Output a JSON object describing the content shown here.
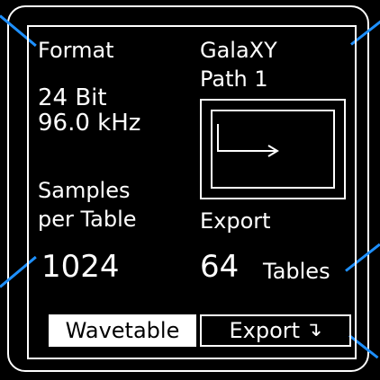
{
  "accent_color": "#1e90ff",
  "format": {
    "label": "Format",
    "bit_depth": "24 Bit",
    "sample_rate": "96.0 kHz"
  },
  "samples": {
    "label_line1": "Samples",
    "label_line2": "per Table",
    "value": "1024"
  },
  "path": {
    "name": "GalaXY",
    "label": "Path 1"
  },
  "export": {
    "label": "Export",
    "count": "64",
    "unit": "Tables",
    "button_label": "Export",
    "button_icon": "export-arrow-icon"
  },
  "buttons": {
    "wavetable_label": "Wavetable"
  }
}
